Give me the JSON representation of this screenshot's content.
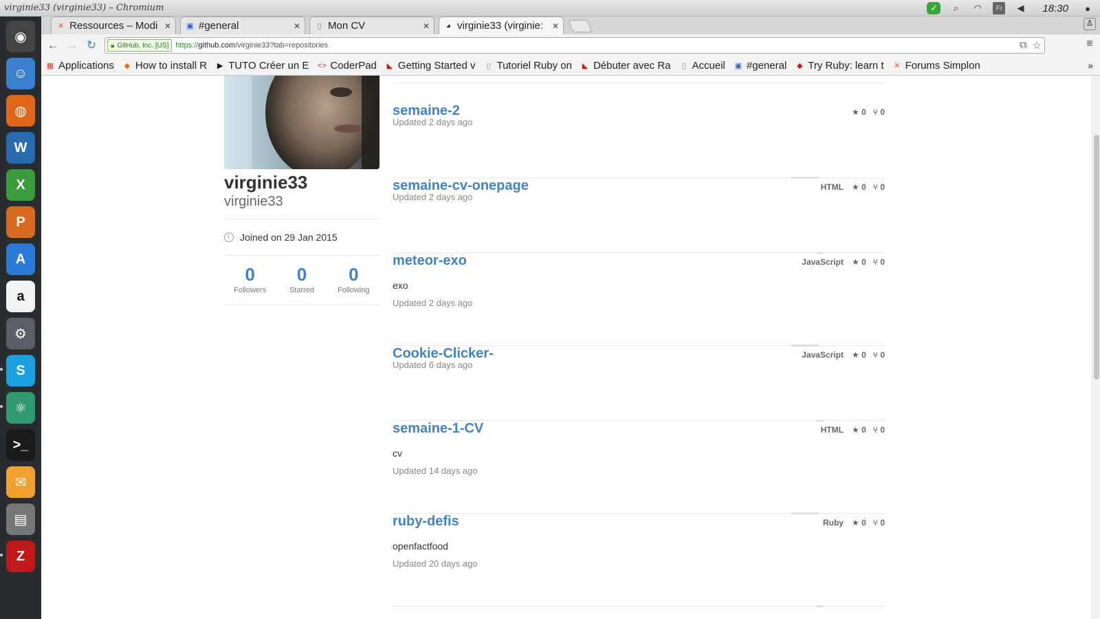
{
  "window": {
    "title": "virginie33 (virginie33) – Chromium",
    "clock": "18:30",
    "keyboard": "Fr"
  },
  "tabs": [
    {
      "title": "Ressources – Modi",
      "favicon": "tools-icon",
      "active": false
    },
    {
      "title": "#general",
      "favicon": "slack-icon",
      "active": false
    },
    {
      "title": "Mon CV",
      "favicon": "document-icon",
      "active": false
    },
    {
      "title": "virginie33 (virginie:",
      "favicon": "github-icon",
      "active": true
    }
  ],
  "address_bar": {
    "ev_label": "GitHub, Inc. [US]",
    "scheme": "https://",
    "host": "github.com",
    "path": "/virginie33?tab=repositories"
  },
  "bookmarks": [
    {
      "label": "Applications",
      "icon": "apps-icon",
      "color": "#d04020"
    },
    {
      "label": "How to install R",
      "icon": "ruby-icon",
      "color": "#e07020"
    },
    {
      "label": "TUTO Créer un E",
      "icon": "play-icon",
      "color": "#111111"
    },
    {
      "label": "CoderPad",
      "icon": "coderpad-icon",
      "color": "#d0302a"
    },
    {
      "label": "Getting Started v",
      "icon": "rails-icon",
      "color": "#c0201a"
    },
    {
      "label": "Tutoriel Ruby on",
      "icon": "document-icon",
      "color": "#888888"
    },
    {
      "label": "Débuter avec Ra",
      "icon": "rails-icon",
      "color": "#c0201a"
    },
    {
      "label": "Accueil",
      "icon": "document-icon",
      "color": "#888888"
    },
    {
      "label": "#general",
      "icon": "slack-icon",
      "color": "#3060c0"
    },
    {
      "label": "Try Ruby: learn t",
      "icon": "ruby-icon",
      "color": "#c02020"
    },
    {
      "label": "Forums Simplon",
      "icon": "tools-icon",
      "color": "#e05a20"
    }
  ],
  "profile": {
    "fullname": "virginie33",
    "username": "virginie33",
    "joined": "Joined on 29 Jan 2015",
    "stats": [
      {
        "value": "0",
        "label": "Followers"
      },
      {
        "value": "0",
        "label": "Starred"
      },
      {
        "value": "0",
        "label": "Following"
      }
    ]
  },
  "repos": [
    {
      "name": "semaine-2",
      "description": "",
      "language": "",
      "stars": "0",
      "forks": "0",
      "updated": "Updated 2 days ago"
    },
    {
      "name": "semaine-cv-onepage",
      "description": "",
      "language": "HTML",
      "stars": "0",
      "forks": "0",
      "updated": "Updated 2 days ago"
    },
    {
      "name": "meteor-exo",
      "description": "exo",
      "language": "JavaScript",
      "stars": "0",
      "forks": "0",
      "updated": "Updated 2 days ago"
    },
    {
      "name": "Cookie-Clicker-",
      "description": "",
      "language": "JavaScript",
      "stars": "0",
      "forks": "0",
      "updated": "Updated 6 days ago"
    },
    {
      "name": "semaine-1-CV",
      "description": "cv",
      "language": "HTML",
      "stars": "0",
      "forks": "0",
      "updated": "Updated 14 days ago"
    },
    {
      "name": "ruby-defis",
      "description": "openfactfood",
      "language": "Ruby",
      "stars": "0",
      "forks": "0",
      "updated": "Updated 20 days ago"
    }
  ],
  "launcher": [
    {
      "name": "ubuntu-icon",
      "color": "#444444",
      "glyph": "◉"
    },
    {
      "name": "finder-icon",
      "color": "#3b7fd0",
      "glyph": "☺"
    },
    {
      "name": "firefox-icon",
      "color": "#e0661b",
      "glyph": "◍"
    },
    {
      "name": "writer-icon",
      "color": "#2a6ab0",
      "glyph": "W"
    },
    {
      "name": "calc-icon",
      "color": "#3c9c3c",
      "glyph": "X"
    },
    {
      "name": "impress-icon",
      "color": "#d86a20",
      "glyph": "P"
    },
    {
      "name": "appstore-icon",
      "color": "#2a7ad8",
      "glyph": "A"
    },
    {
      "name": "amazon-icon",
      "color": "#f2f2f2",
      "glyph": "a"
    },
    {
      "name": "settings-icon",
      "color": "#5a5f66",
      "glyph": "⚙"
    },
    {
      "name": "skype-icon",
      "color": "#1aa0e0",
      "glyph": "S"
    },
    {
      "name": "atom-icon",
      "color": "#2f9a70",
      "glyph": "⚛"
    },
    {
      "name": "terminal-icon",
      "color": "#1a1a1a",
      "glyph": ">_"
    },
    {
      "name": "mail-icon",
      "color": "#f0a030",
      "glyph": "✉"
    },
    {
      "name": "disk-icon",
      "color": "#777777",
      "glyph": "▤"
    },
    {
      "name": "filezilla-icon",
      "color": "#c01818",
      "glyph": "Z"
    }
  ]
}
